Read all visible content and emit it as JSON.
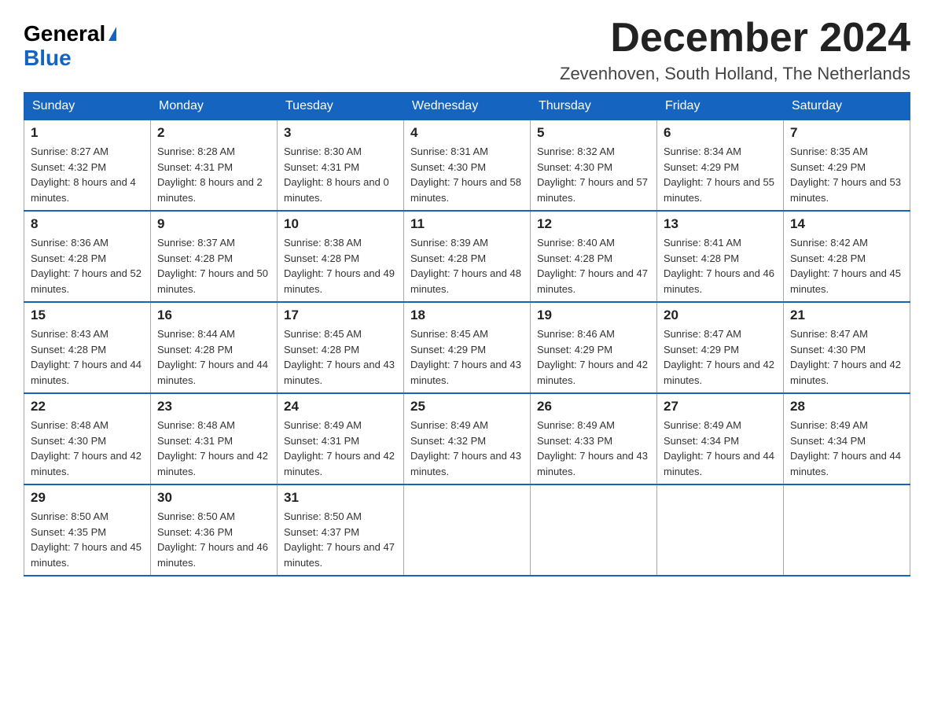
{
  "logo": {
    "general": "General",
    "blue": "Blue"
  },
  "header": {
    "month": "December 2024",
    "location": "Zevenhoven, South Holland, The Netherlands"
  },
  "days_of_week": [
    "Sunday",
    "Monday",
    "Tuesday",
    "Wednesday",
    "Thursday",
    "Friday",
    "Saturday"
  ],
  "weeks": [
    [
      {
        "day": "1",
        "sunrise": "8:27 AM",
        "sunset": "4:32 PM",
        "daylight": "8 hours and 4 minutes."
      },
      {
        "day": "2",
        "sunrise": "8:28 AM",
        "sunset": "4:31 PM",
        "daylight": "8 hours and 2 minutes."
      },
      {
        "day": "3",
        "sunrise": "8:30 AM",
        "sunset": "4:31 PM",
        "daylight": "8 hours and 0 minutes."
      },
      {
        "day": "4",
        "sunrise": "8:31 AM",
        "sunset": "4:30 PM",
        "daylight": "7 hours and 58 minutes."
      },
      {
        "day": "5",
        "sunrise": "8:32 AM",
        "sunset": "4:30 PM",
        "daylight": "7 hours and 57 minutes."
      },
      {
        "day": "6",
        "sunrise": "8:34 AM",
        "sunset": "4:29 PM",
        "daylight": "7 hours and 55 minutes."
      },
      {
        "day": "7",
        "sunrise": "8:35 AM",
        "sunset": "4:29 PM",
        "daylight": "7 hours and 53 minutes."
      }
    ],
    [
      {
        "day": "8",
        "sunrise": "8:36 AM",
        "sunset": "4:28 PM",
        "daylight": "7 hours and 52 minutes."
      },
      {
        "day": "9",
        "sunrise": "8:37 AM",
        "sunset": "4:28 PM",
        "daylight": "7 hours and 50 minutes."
      },
      {
        "day": "10",
        "sunrise": "8:38 AM",
        "sunset": "4:28 PM",
        "daylight": "7 hours and 49 minutes."
      },
      {
        "day": "11",
        "sunrise": "8:39 AM",
        "sunset": "4:28 PM",
        "daylight": "7 hours and 48 minutes."
      },
      {
        "day": "12",
        "sunrise": "8:40 AM",
        "sunset": "4:28 PM",
        "daylight": "7 hours and 47 minutes."
      },
      {
        "day": "13",
        "sunrise": "8:41 AM",
        "sunset": "4:28 PM",
        "daylight": "7 hours and 46 minutes."
      },
      {
        "day": "14",
        "sunrise": "8:42 AM",
        "sunset": "4:28 PM",
        "daylight": "7 hours and 45 minutes."
      }
    ],
    [
      {
        "day": "15",
        "sunrise": "8:43 AM",
        "sunset": "4:28 PM",
        "daylight": "7 hours and 44 minutes."
      },
      {
        "day": "16",
        "sunrise": "8:44 AM",
        "sunset": "4:28 PM",
        "daylight": "7 hours and 44 minutes."
      },
      {
        "day": "17",
        "sunrise": "8:45 AM",
        "sunset": "4:28 PM",
        "daylight": "7 hours and 43 minutes."
      },
      {
        "day": "18",
        "sunrise": "8:45 AM",
        "sunset": "4:29 PM",
        "daylight": "7 hours and 43 minutes."
      },
      {
        "day": "19",
        "sunrise": "8:46 AM",
        "sunset": "4:29 PM",
        "daylight": "7 hours and 42 minutes."
      },
      {
        "day": "20",
        "sunrise": "8:47 AM",
        "sunset": "4:29 PM",
        "daylight": "7 hours and 42 minutes."
      },
      {
        "day": "21",
        "sunrise": "8:47 AM",
        "sunset": "4:30 PM",
        "daylight": "7 hours and 42 minutes."
      }
    ],
    [
      {
        "day": "22",
        "sunrise": "8:48 AM",
        "sunset": "4:30 PM",
        "daylight": "7 hours and 42 minutes."
      },
      {
        "day": "23",
        "sunrise": "8:48 AM",
        "sunset": "4:31 PM",
        "daylight": "7 hours and 42 minutes."
      },
      {
        "day": "24",
        "sunrise": "8:49 AM",
        "sunset": "4:31 PM",
        "daylight": "7 hours and 42 minutes."
      },
      {
        "day": "25",
        "sunrise": "8:49 AM",
        "sunset": "4:32 PM",
        "daylight": "7 hours and 43 minutes."
      },
      {
        "day": "26",
        "sunrise": "8:49 AM",
        "sunset": "4:33 PM",
        "daylight": "7 hours and 43 minutes."
      },
      {
        "day": "27",
        "sunrise": "8:49 AM",
        "sunset": "4:34 PM",
        "daylight": "7 hours and 44 minutes."
      },
      {
        "day": "28",
        "sunrise": "8:49 AM",
        "sunset": "4:34 PM",
        "daylight": "7 hours and 44 minutes."
      }
    ],
    [
      {
        "day": "29",
        "sunrise": "8:50 AM",
        "sunset": "4:35 PM",
        "daylight": "7 hours and 45 minutes."
      },
      {
        "day": "30",
        "sunrise": "8:50 AM",
        "sunset": "4:36 PM",
        "daylight": "7 hours and 46 minutes."
      },
      {
        "day": "31",
        "sunrise": "8:50 AM",
        "sunset": "4:37 PM",
        "daylight": "7 hours and 47 minutes."
      },
      null,
      null,
      null,
      null
    ]
  ]
}
